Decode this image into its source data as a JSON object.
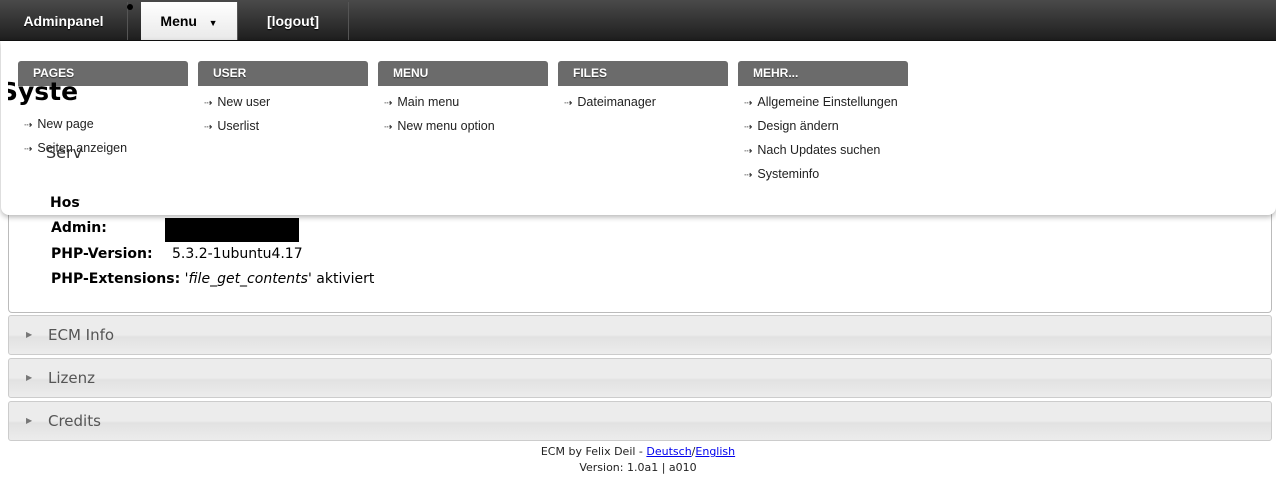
{
  "topbar": {
    "tabs": [
      "Adminpanel",
      "Menu",
      "[logout]"
    ],
    "menu_caret": "▼"
  },
  "menu": {
    "columns": [
      {
        "title": "PAGES",
        "items": [
          "New page",
          "Seiten anzeigen"
        ]
      },
      {
        "title": "USER",
        "items": [
          "New user",
          "Userlist"
        ]
      },
      {
        "title": "MENU",
        "items": [
          "Main menu",
          "New menu option"
        ]
      },
      {
        "title": "FILES",
        "items": [
          "Dateimanager"
        ]
      },
      {
        "title": "MEHR...",
        "items": [
          "Allgemeine Einstellungen",
          "Design ändern",
          "Nach Updates suchen",
          "Systeminfo"
        ]
      }
    ]
  },
  "background": {
    "heading_fragment": "Syste",
    "section_fragment": "Serv",
    "host_fragment": "Host"
  },
  "info": {
    "admin_label": "Admin:",
    "php_version_label": "PHP-Version:",
    "php_version": "5.3.2-1ubuntu4.17",
    "php_ext_label": "PHP-Extensions:",
    "php_ext_value": "file_get_contents",
    "php_ext_status": "aktiviert"
  },
  "accordion": [
    "ECM Info",
    "Lizenz",
    "Credits"
  ],
  "footer": {
    "credit": "ECM by Felix Deil - ",
    "lang_de": "Deutsch",
    "sep": "/",
    "lang_en": "English",
    "version": "Version: 1.0a1 | a010"
  }
}
